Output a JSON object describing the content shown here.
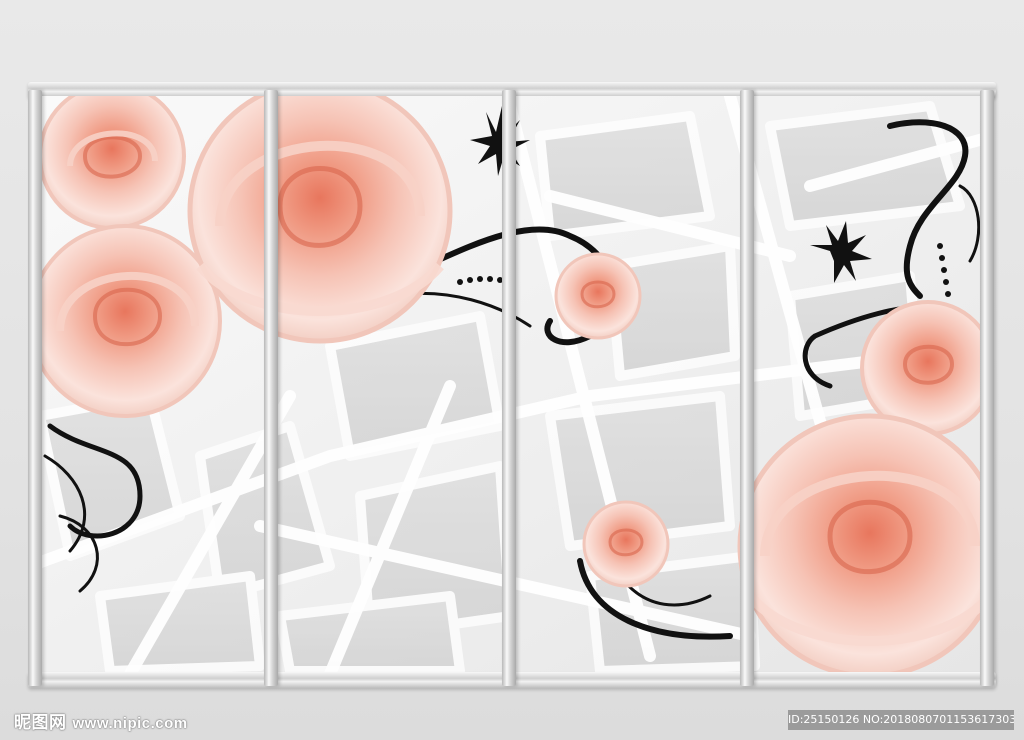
{
  "watermark": {
    "logo": "昵图网",
    "site": "www.nipic.com",
    "id_text": "ID:25150126 NO:20180807011536173031"
  },
  "palette": {
    "background": "#e6e6e6",
    "frame": "#d0d0d0",
    "rose_light": "#f9d6cc",
    "rose_mid": "#f2a996",
    "rose_center": "#e8765d",
    "ornament": "#111111"
  }
}
